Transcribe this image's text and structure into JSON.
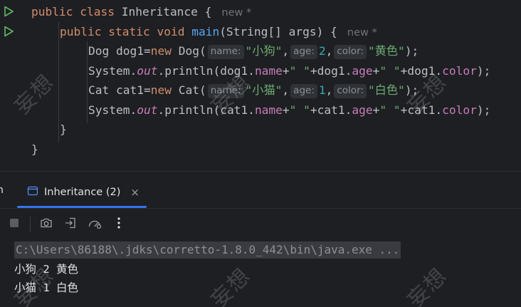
{
  "editor": {
    "line1": {
      "kw1": "public",
      "kw2": "class",
      "name": "Inheritance",
      "brace": "{",
      "hint": "new *"
    },
    "line2": {
      "kw1": "public",
      "kw2": "static",
      "kw3": "void",
      "method": "main",
      "params": "(String[] args)",
      "brace": "{",
      "hint": "new *"
    },
    "line3": {
      "prefix": "Dog dog1=",
      "kw": "new",
      "ctor": "Dog(",
      "h1": "name:",
      "v1": "\"小狗\"",
      "h2": "age:",
      "v2": "2",
      "h3": "color:",
      "v3": "\"黄色\"",
      "end": ");"
    },
    "line4": {
      "a": "System.",
      "out": "out",
      "b": ".println(dog1.",
      "f1": "name",
      "c": "+",
      "s1": "\" \"",
      "d": "+dog1.",
      "f2": "age",
      "e": "+",
      "s2": "\" \"",
      "g": "+dog1.",
      "f3": "color",
      "end": ");"
    },
    "line5": {
      "prefix": "Cat cat1=",
      "kw": "new",
      "ctor": "Cat(",
      "h1": "name:",
      "v1": "\"小猫\"",
      "h2": "age:",
      "v2": "1",
      "h3": "color:",
      "v3": "\"白色\"",
      "end": ");"
    },
    "line6": {
      "a": "System.",
      "out": "out",
      "b": ".println(cat1.",
      "f1": "name",
      "c": "+",
      "s1": "\" \"",
      "d": "+cat1.",
      "f2": "age",
      "e": "+",
      "s2": "\" \"",
      "g": "+cat1.",
      "f3": "color",
      "end": ");"
    },
    "line7": "}",
    "line8": "}"
  },
  "run_panel": {
    "left_cut": "n",
    "tab_label": "Inheritance (2)",
    "tab_close": "×",
    "command": "C:\\Users\\86188\\.jdks\\corretto-1.8.0_442\\bin\\java.exe ...",
    "output": [
      "小狗 2 黄色",
      "小猫 1 白色"
    ]
  },
  "watermark": "妄想",
  "colors": {
    "accent": "#3574f0",
    "run_icon": "#5fb865",
    "background": "#1e1f22"
  },
  "icons": [
    "run-icon",
    "console-tab-icon",
    "stop-icon",
    "camera-icon",
    "login-icon",
    "gauge-icon",
    "more-vertical-icon"
  ]
}
